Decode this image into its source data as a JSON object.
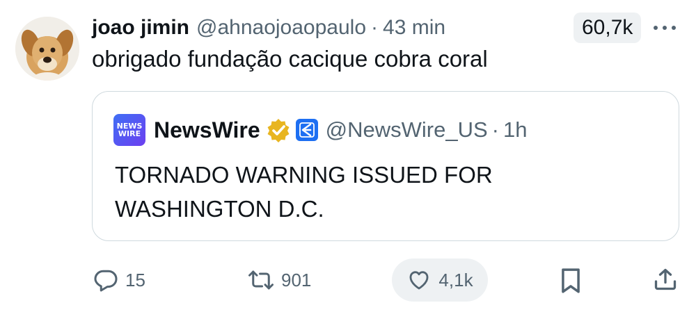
{
  "tweet": {
    "display_name": "joao jimin",
    "handle": "@ahnaojoaopaulo",
    "separator": "·",
    "time_ago": "43 min",
    "views": "60,7k",
    "text": "obrigado fundação cacique cobra coral"
  },
  "quote": {
    "logo_text_top": "NEWS",
    "logo_text_bottom": "WIRE",
    "display_name": "NewsWire",
    "handle": "@NewsWire_US",
    "separator": "·",
    "time_ago": "1h",
    "text": "TORNADO WARNING ISSUED FOR WASHINGTON D.C."
  },
  "actions": {
    "replies": "15",
    "reposts": "901",
    "likes": "4,1k"
  },
  "colors": {
    "text": "#0f1419",
    "secondary": "#536471",
    "border": "#cfd9de",
    "verified_gold": "#e8b520",
    "affiliate_blue": "#1d6ff2",
    "pill_bg": "#eef1f3"
  },
  "icons": [
    "dog-avatar",
    "more-icon",
    "newswire-logo",
    "verified-badge-icon",
    "affiliate-badge-icon",
    "reply-icon",
    "repost-icon",
    "like-icon",
    "bookmark-icon",
    "share-icon"
  ]
}
